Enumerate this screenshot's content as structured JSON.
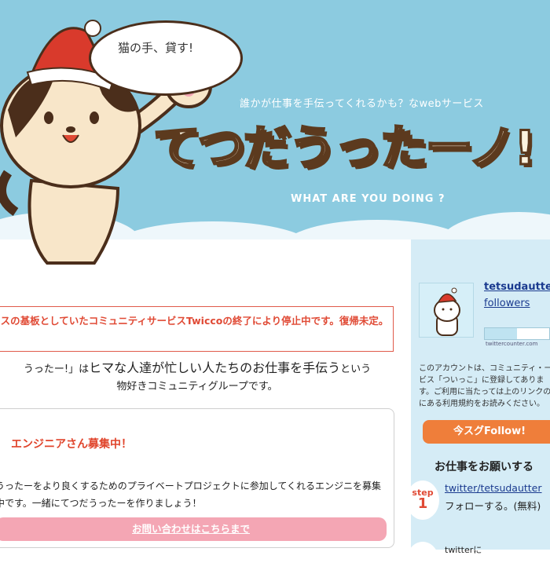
{
  "header": {
    "bubble": "猫の手、貸す!",
    "subtitle": "誰かが仕事を手伝ってくれるかも？なwebサービス",
    "logo": "てつだうったーノ!",
    "tagline": "WHAT ARE YOU DOING ?"
  },
  "notice": {
    "text": "スの基板としていたコミュニティサービスTwiccoの終了により停止中です。復帰未定。"
  },
  "intro": {
    "line1_prefix": "うったー!」は",
    "line1_big": "ヒマな人達が忙しい人たちのお仕事を手伝う",
    "line1_suffix": "という",
    "line2": "物好きコミュニティグループです。"
  },
  "recruit": {
    "title": "エンジニアさん募集中！",
    "body": "うったーをより良くするためのプライベートプロジェクトに参加してくれるエンジニを募集中です。一緒にてつだうったーを作りましょう！",
    "contact_button": "お問い合わせはこちらまで"
  },
  "sidebar": {
    "account_name": "tetsudautter",
    "followers_label": "followers",
    "counter_label": "twittercounter.com",
    "counter_fill": 0.5,
    "description": "このアカウントは、コミュニティ・ービス「ついっこ」に登録してありま す。ご利用に当たっては上のリンクのにある利用規約をお読みください。",
    "follow_button": "今スグFollow!",
    "heading": "お仕事をお願いする",
    "step1_label": "step",
    "step1_num": "1",
    "step1_link": "twitter/tetsudautter",
    "step1_text": "フォローする。(無料)",
    "step2_text": "twitterに"
  },
  "colors": {
    "header_bg": "#8ccbe0",
    "sidebar_bg": "#d5ecf6",
    "notice_red": "#e04a35",
    "follow_orange": "#ef7e3a",
    "contact_pink": "#f4a6b4"
  }
}
